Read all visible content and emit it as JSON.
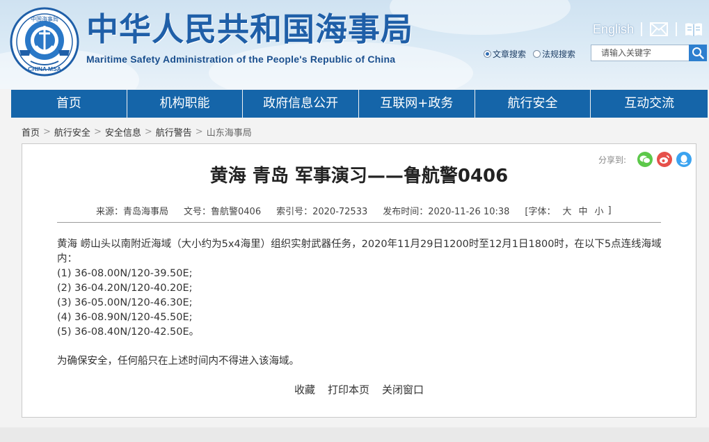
{
  "header": {
    "title_cn": "中华人民共和国海事局",
    "title_en": "Maritime Safety Administration of the People's Republic of China",
    "logo_text_top": "中国海事局",
    "logo_text_bottom": "CHINA MSA",
    "english_link": "English"
  },
  "search": {
    "options": [
      {
        "label": "文章搜索",
        "checked": true
      },
      {
        "label": "法规搜索",
        "checked": false
      }
    ],
    "placeholder": "请输入关键字"
  },
  "nav": {
    "items": [
      "首页",
      "机构职能",
      "政府信息公开",
      "互联网+政务",
      "航行安全",
      "互动交流"
    ]
  },
  "breadcrumb": [
    "首页",
    "航行安全",
    "安全信息",
    "航行警告",
    "山东海事局"
  ],
  "breadcrumb_sep": ">",
  "share": {
    "label": "分享到:",
    "icons": [
      "wechat-icon",
      "weibo-icon",
      "qq-icon"
    ]
  },
  "article": {
    "title": "黄海 青岛 军事演习——鲁航警0406",
    "meta": {
      "source": "来源：青岛海事局",
      "doc_no": "文号：鲁航警0406",
      "index_no": "索引号：2020-72533",
      "publish_time": "发布时间：2020-11-26 10:38",
      "font_label": "[字体：",
      "font_large": "大",
      "font_medium": "中",
      "font_small": "小",
      "font_close": "]"
    },
    "paragraph1": "黄海  崂山头以南附近海域（大小约为5x4海里）组织实射武器任务，2020年11月29日1200时至12月1日1800时，在以下5点连线海域内：",
    "points": [
      "(1) 36-08.00N/120-39.50E;",
      "(2) 36-04.20N/120-40.20E;",
      "(3) 36-05.00N/120-46.30E;",
      "(4) 36-08.90N/120-45.50E;",
      "(5) 36-08.40N/120-42.50E。"
    ],
    "paragraph2": "为确保安全，任何船只在上述时间内不得进入该海域。"
  },
  "actions": [
    "收藏",
    "打印本页",
    "关闭窗口"
  ],
  "colors": {
    "nav_bg": "#1565a9",
    "title_blue": "#1f5fa8",
    "search_btn": "#2d7fcf"
  }
}
